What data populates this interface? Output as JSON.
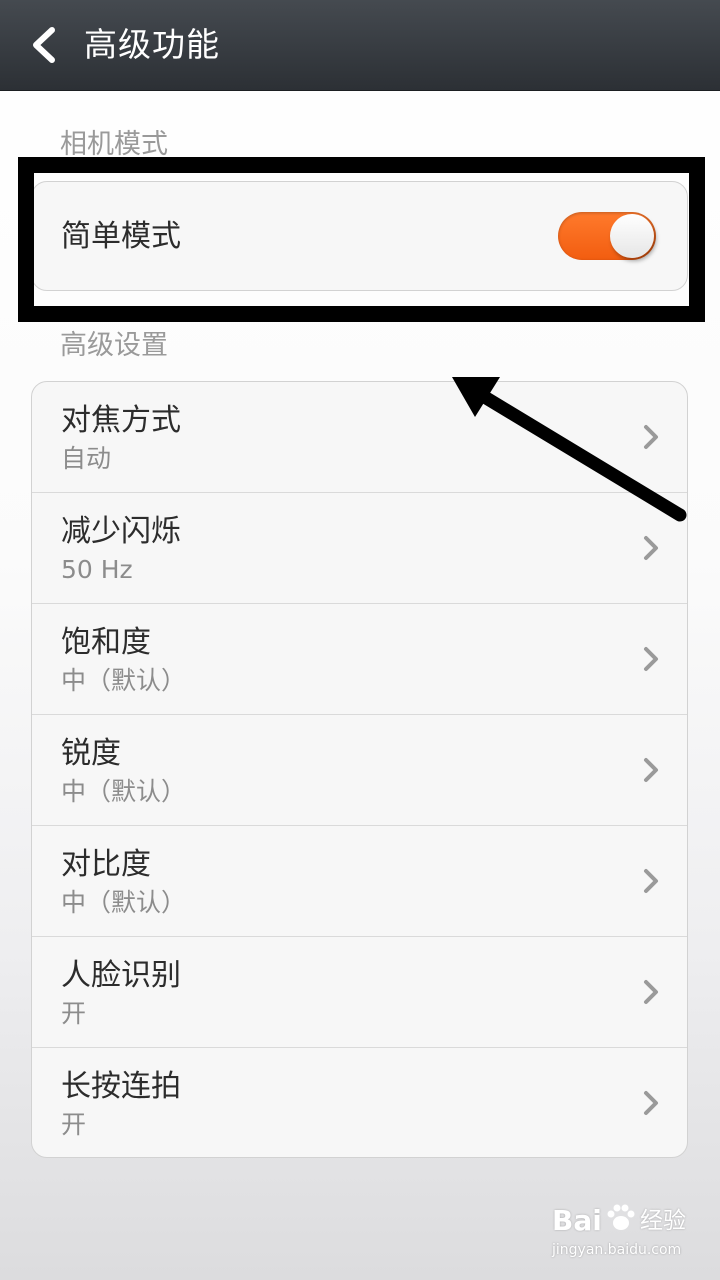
{
  "header": {
    "title": "高级功能",
    "back_icon": "chevron-left-icon"
  },
  "camera_mode": {
    "section_label": "相机模式",
    "simple_mode_label": "简单模式",
    "simple_mode_on": true,
    "toggle_color": "#f2621a"
  },
  "advanced": {
    "section_label": "高级设置",
    "items": [
      {
        "title": "对焦方式",
        "value": "自动"
      },
      {
        "title": "减少闪烁",
        "value": "50 Hz"
      },
      {
        "title": "饱和度",
        "value": "中（默认）"
      },
      {
        "title": "锐度",
        "value": "中（默认）"
      },
      {
        "title": "对比度",
        "value": "中（默认）"
      },
      {
        "title": "人脸识别",
        "value": "开"
      },
      {
        "title": "长按连拍",
        "value": "开"
      }
    ],
    "item_icon": "chevron-right-icon"
  },
  "annotation": {
    "box_color": "#000000",
    "arrow_icon": "arrow-icon"
  },
  "watermark": {
    "brand": "Bai",
    "suffix": "经验",
    "url": "jingyan.baidu.com"
  }
}
